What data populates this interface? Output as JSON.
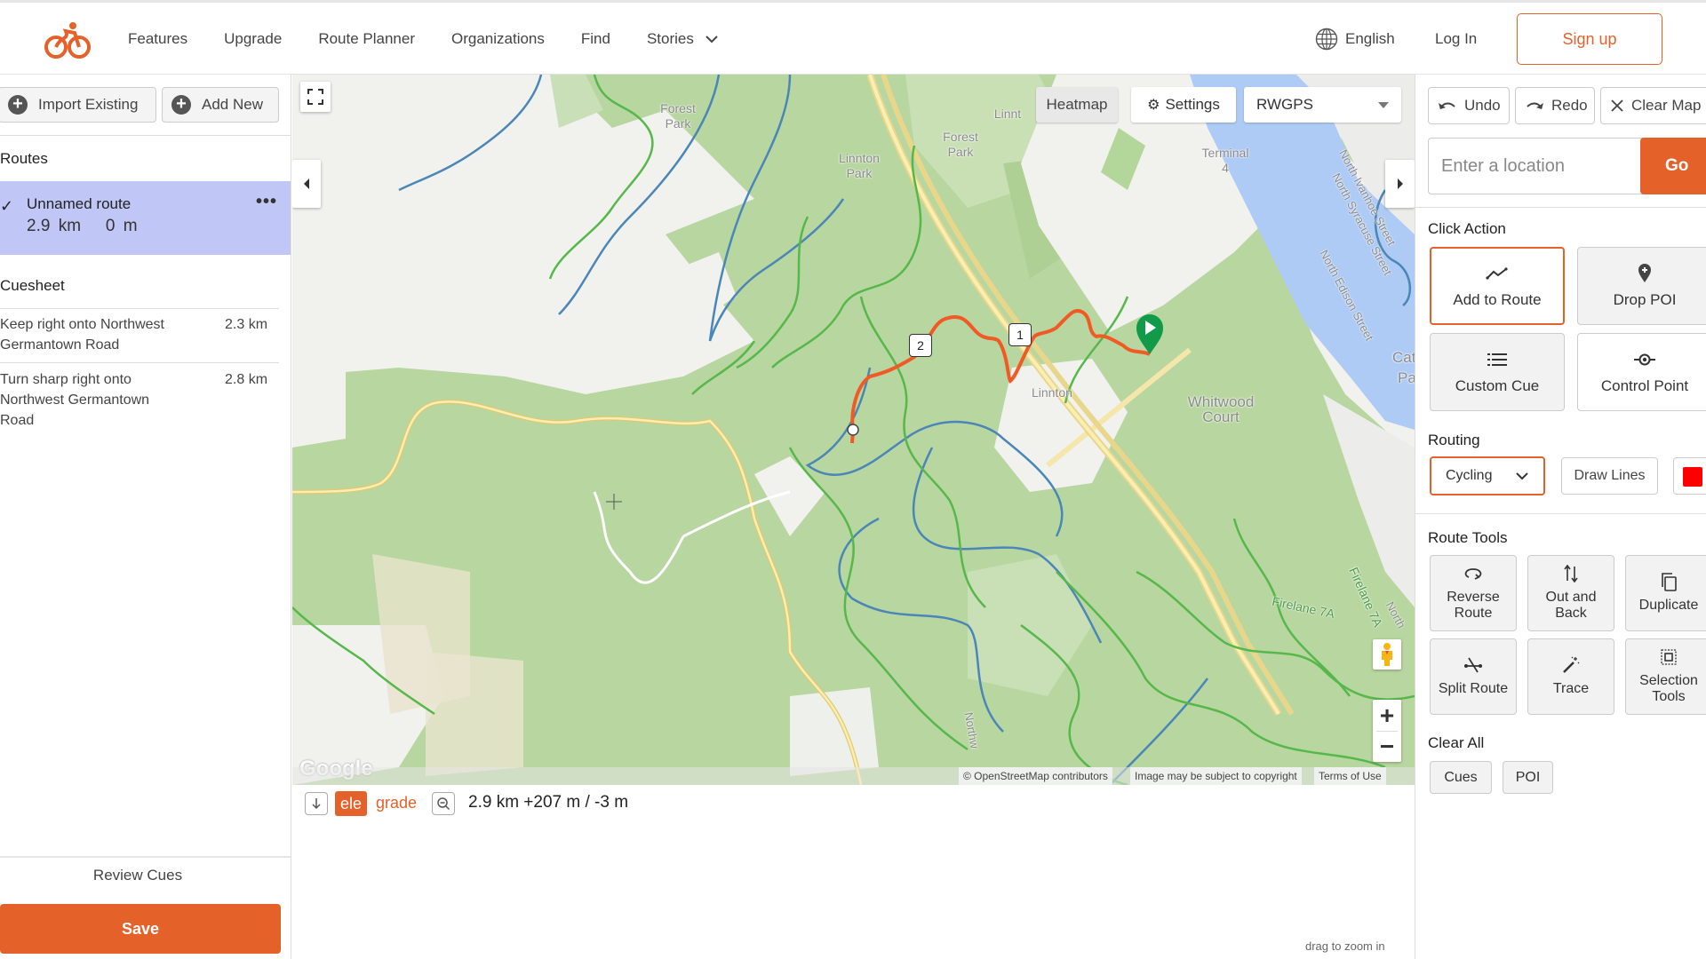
{
  "header": {
    "nav": [
      {
        "label": "Features"
      },
      {
        "label": "Upgrade"
      },
      {
        "label": "Route Planner"
      },
      {
        "label": "Organizations"
      },
      {
        "label": "Find"
      },
      {
        "label": "Stories",
        "has_dropdown": true
      }
    ],
    "language": "English",
    "login": "Log In",
    "signup": "Sign up",
    "brand_color": "#e4622a"
  },
  "sidebar": {
    "import_label": "Import Existing",
    "add_new_label": "Add New",
    "routes_heading": "Routes",
    "routes": [
      {
        "name": "Unnamed route",
        "distance": "2.9 km",
        "elevation": "0 m",
        "selected": true
      }
    ],
    "cuesheet_heading": "Cuesheet",
    "cues": [
      {
        "text": "Keep right onto Northwest Germantown Road",
        "distance": "2.3 km"
      },
      {
        "text": "Turn sharp right onto Northwest Germantown Road",
        "distance": "2.8 km"
      }
    ],
    "review_cues": "Review Cues",
    "save": "Save"
  },
  "map": {
    "heatmap_label": "Heatmap",
    "settings_label": "Settings",
    "layer_selected": "RWGPS",
    "labels": {
      "forest_park_1": "Forest Park",
      "forest_park_2": "Forest Park",
      "linnton_park": "Linnton Park",
      "linnton_top": "Linnt",
      "linnton": "Linnton",
      "terminal": "Terminal 4",
      "whitwood": "Whitwood Court",
      "firelane_1": "Firelane 7A",
      "firelane_2": "Firelane 7A",
      "north_ivanhoe": "North Ivanhoe Street",
      "north_syracuse": "North Syracuse Street",
      "north_edison": "North Edison Street",
      "cath": "Cath",
      "pa": "Pa",
      "northwest": "Northw",
      "north_bottom": "North"
    },
    "markers": [
      {
        "label": "1"
      },
      {
        "label": "2"
      }
    ],
    "google_logo": "Google",
    "attribution": {
      "osm": "© OpenStreetMap contributors",
      "copyright": "Image may be subject to copyright",
      "terms": "Terms of Use"
    },
    "route_color": "#f15a24"
  },
  "elevation": {
    "ele_tab": "ele",
    "grade_tab": "grade",
    "stats": "2.9 km +207 m / -3 m",
    "drag_hint": "drag to zoom in"
  },
  "right_panel": {
    "undo": "Undo",
    "redo": "Redo",
    "clear_map": "Clear Map",
    "location_placeholder": "Enter a location",
    "go": "Go",
    "click_action_heading": "Click Action",
    "click_actions": [
      {
        "label": "Add to Route",
        "active": true
      },
      {
        "label": "Drop POI"
      },
      {
        "label": "Custom Cue"
      },
      {
        "label": "Control Point"
      }
    ],
    "routing_heading": "Routing",
    "routing_mode": "Cycling",
    "draw_lines": "Draw Lines",
    "route_color": "#ff0000",
    "route_tools_heading": "Route Tools",
    "route_tools": [
      {
        "label": "Reverse Route"
      },
      {
        "label": "Out and Back"
      },
      {
        "label": "Duplicate"
      },
      {
        "label": "Split Route"
      },
      {
        "label": "Trace"
      },
      {
        "label": "Selection Tools"
      }
    ],
    "clear_all_heading": "Clear All",
    "clear_cues": "Cues",
    "clear_poi": "POI"
  }
}
